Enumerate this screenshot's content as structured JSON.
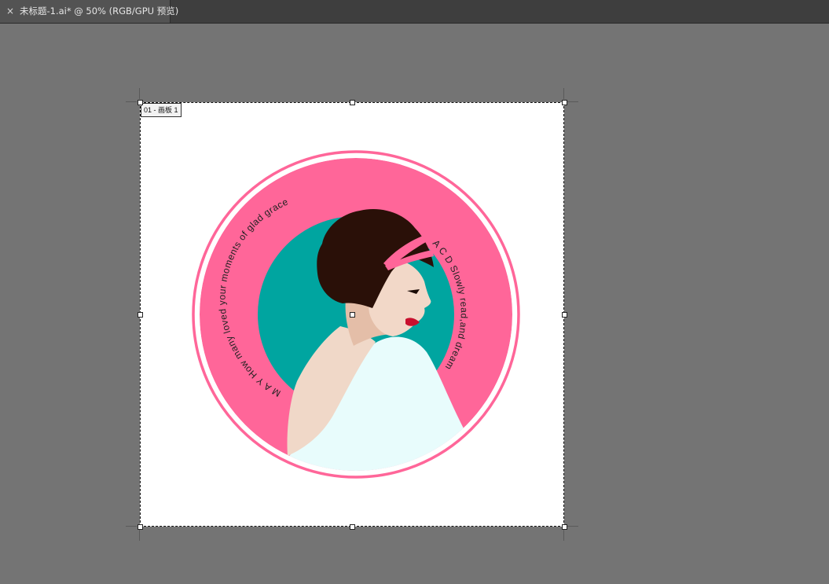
{
  "tab": {
    "close_glyph": "×",
    "title": "未标题-1.ai* @ 50% (RGB/GPU 预览)"
  },
  "artboard": {
    "label": "01 - 画板 1"
  },
  "artwork": {
    "arc_text_left": "M A Y   How many loved your moments of glad grace",
    "arc_text_right": "A C D   Slowly read,and dream",
    "colors": {
      "pink": "#ff6699",
      "teal": "#00a5a0",
      "hair": "#2a1008",
      "skin": "#f0d8c8",
      "dress": "#e8fcfc",
      "lips": "#c8102e"
    }
  }
}
